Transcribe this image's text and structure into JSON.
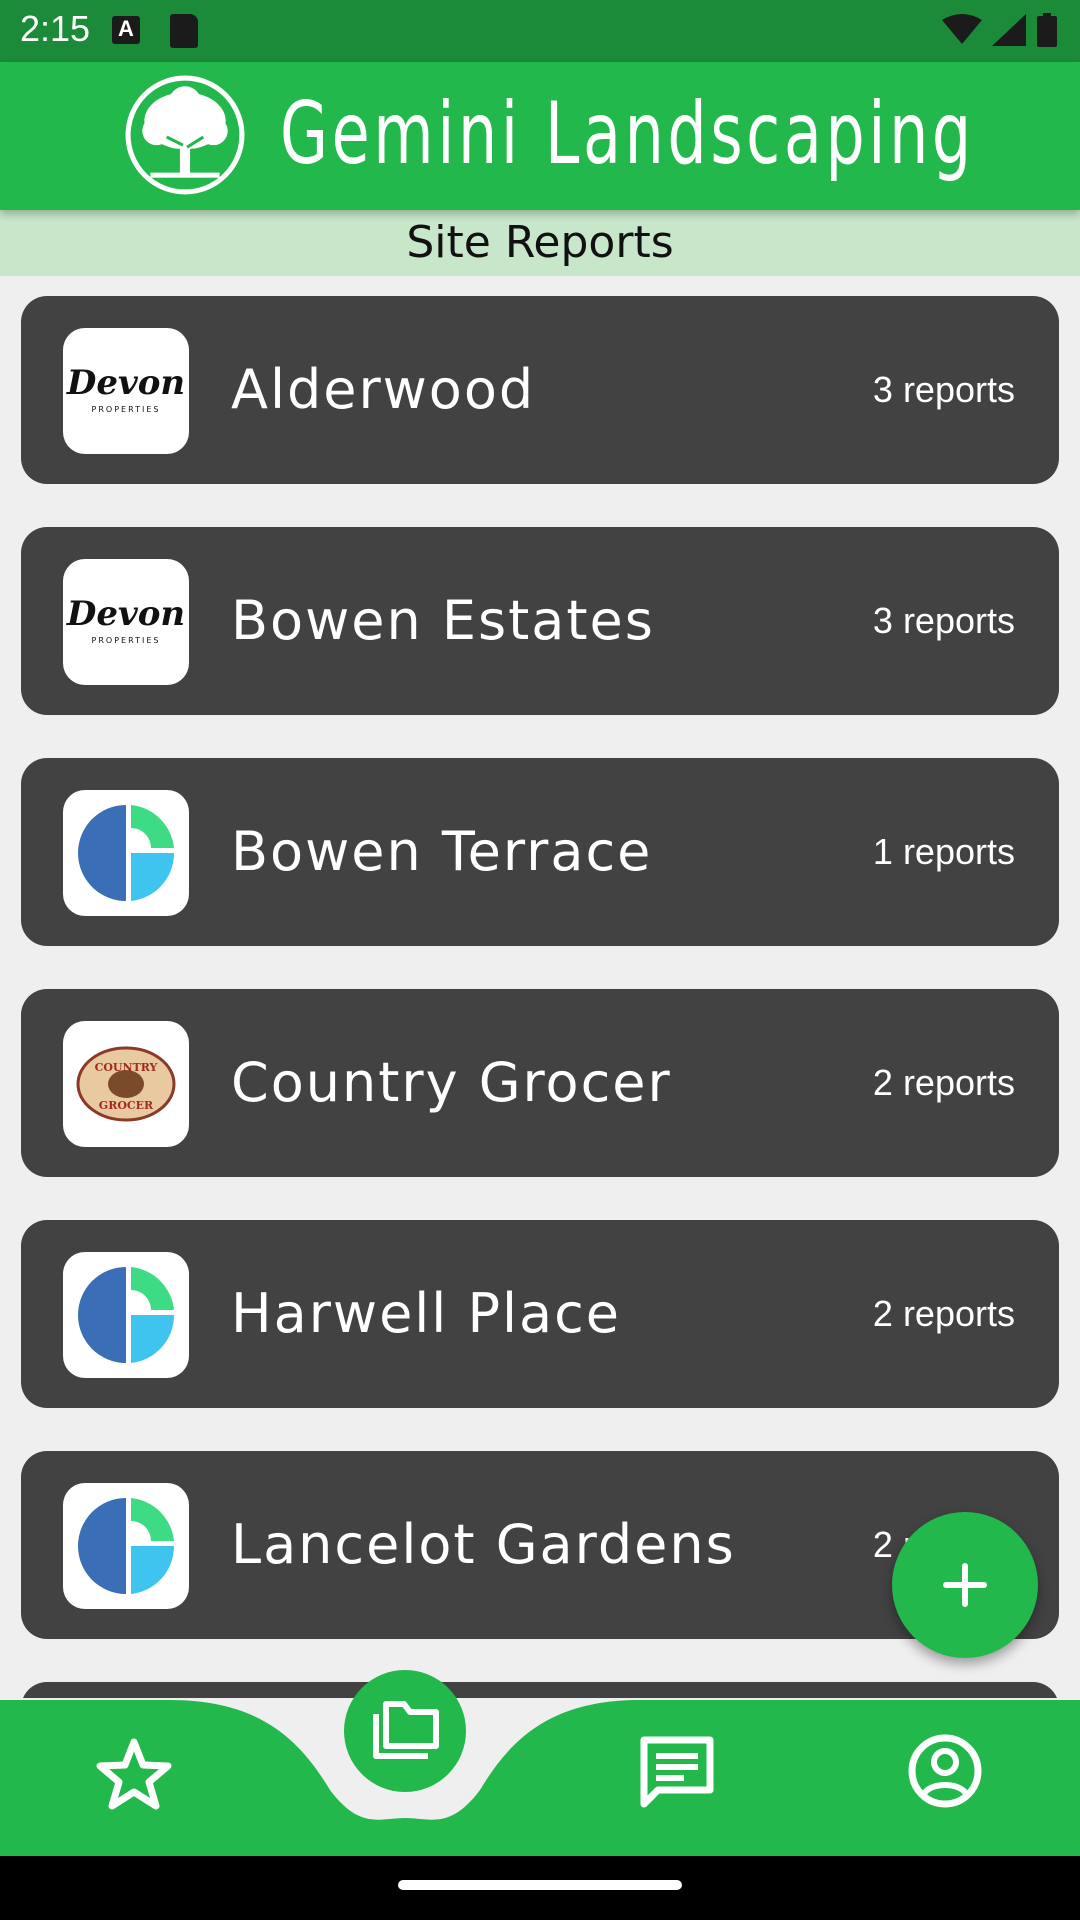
{
  "status_bar": {
    "time": "2:15"
  },
  "app_bar": {
    "title": "Gemini Landscaping",
    "logo_icon": "tree-logo"
  },
  "subheader": {
    "title": "Site Reports"
  },
  "sites": [
    {
      "name": "Alderwood",
      "reports": "3 reports",
      "logo": "devon-properties-logo",
      "logo_text": "Devon",
      "logo_subtext": "PROPERTIES"
    },
    {
      "name": "Bowen Estates",
      "reports": "3 reports",
      "logo": "devon-properties-logo",
      "logo_text": "Devon",
      "logo_subtext": "PROPERTIES"
    },
    {
      "name": "Bowen Terrace",
      "reports": "1 reports",
      "logo": "semicircle-logo"
    },
    {
      "name": "Country Grocer",
      "reports": "2 reports",
      "logo": "country-grocer-logo",
      "logo_text": "COUNTRY",
      "logo_subtext": "GROCER"
    },
    {
      "name": "Harwell Place",
      "reports": "2 reports",
      "logo": "semicircle-logo"
    },
    {
      "name": "Lancelot Gardens",
      "reports": "2 reports",
      "logo": "semicircle-logo"
    }
  ],
  "fab": {
    "icon": "plus-icon"
  },
  "bottom_nav": {
    "items": [
      {
        "icon": "star-icon",
        "selected": false
      },
      {
        "icon": "folder-icon",
        "selected": true
      },
      {
        "icon": "chat-icon",
        "selected": false
      },
      {
        "icon": "account-icon",
        "selected": false
      }
    ]
  },
  "colors": {
    "primary": "#22b84c",
    "status_bar": "#1b8b3a",
    "subheader": "#c8e6c9",
    "card": "#424242",
    "background": "#efefef"
  }
}
